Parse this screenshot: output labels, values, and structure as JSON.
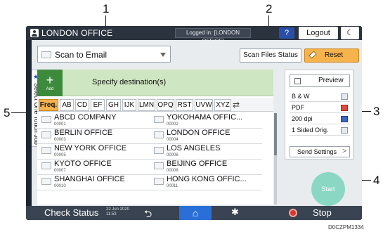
{
  "callouts": {
    "c1": "1",
    "c2": "2",
    "c3": "3",
    "c4": "4",
    "c5": "5"
  },
  "topbar": {
    "title": "LONDON OFFICE",
    "login_status": "Logged in: [LONDON OFFICE]",
    "help_label": "?",
    "logout_label": "Logout",
    "moon_label": "☾"
  },
  "mode_select": {
    "value": "Scan to Email"
  },
  "scan_files_status_label": "Scan Files Status",
  "reset_label": "Reset",
  "specify": {
    "add_symbol": "+",
    "add_label": "Add",
    "text": "Specify destination(s)"
  },
  "side_tab_label": "Select One Touch Job",
  "tabs": [
    {
      "label": "Freq.",
      "active": true
    },
    {
      "label": "AB"
    },
    {
      "label": "CD"
    },
    {
      "label": "EF"
    },
    {
      "label": "GH"
    },
    {
      "label": "IJK"
    },
    {
      "label": "LMN"
    },
    {
      "label": "OPQ"
    },
    {
      "label": "RST"
    },
    {
      "label": "UVW"
    },
    {
      "label": "XYZ"
    }
  ],
  "destinations": [
    {
      "name": "ABCD COMPANY",
      "num": "00001"
    },
    {
      "name": "YOKOHAMA OFFIC...",
      "num": "00002"
    },
    {
      "name": "BERLIN OFFICE",
      "num": "00003"
    },
    {
      "name": "LONDON OFFICE",
      "num": "00004"
    },
    {
      "name": "NEW YORK OFFICE",
      "num": "00005"
    },
    {
      "name": "LOS ANGELES",
      "num": "00006"
    },
    {
      "name": "KYOTO OFFICE",
      "num": "00007"
    },
    {
      "name": "BEIJING OFFICE",
      "num": "00008"
    },
    {
      "name": "SHANGHAI  OFFICE",
      "num": "00010"
    },
    {
      "name": "HONG KONG OFFIC...",
      "num": "00011"
    }
  ],
  "side_panel": {
    "preview_label": "Preview",
    "settings": [
      {
        "label": "B & W"
      },
      {
        "label": "PDF"
      },
      {
        "label": "200 dpi"
      },
      {
        "label": "1 Sided Orig."
      }
    ],
    "send_settings_label": "Send Settings"
  },
  "start_label": "Start",
  "bottombar": {
    "check_status": "Check Status",
    "date": "22 Jun 2020",
    "time": "11:53",
    "stop_label": "Stop"
  },
  "figure_id": "D0CZPM1334",
  "colors": {
    "accent_orange": "#f6b24b",
    "home_blue": "#2a6fd8",
    "add_green": "#3c8a3c",
    "specify_bg": "#cfe6c2",
    "stop_red": "#d63b2e",
    "start_teal": "#8ad8c4"
  }
}
